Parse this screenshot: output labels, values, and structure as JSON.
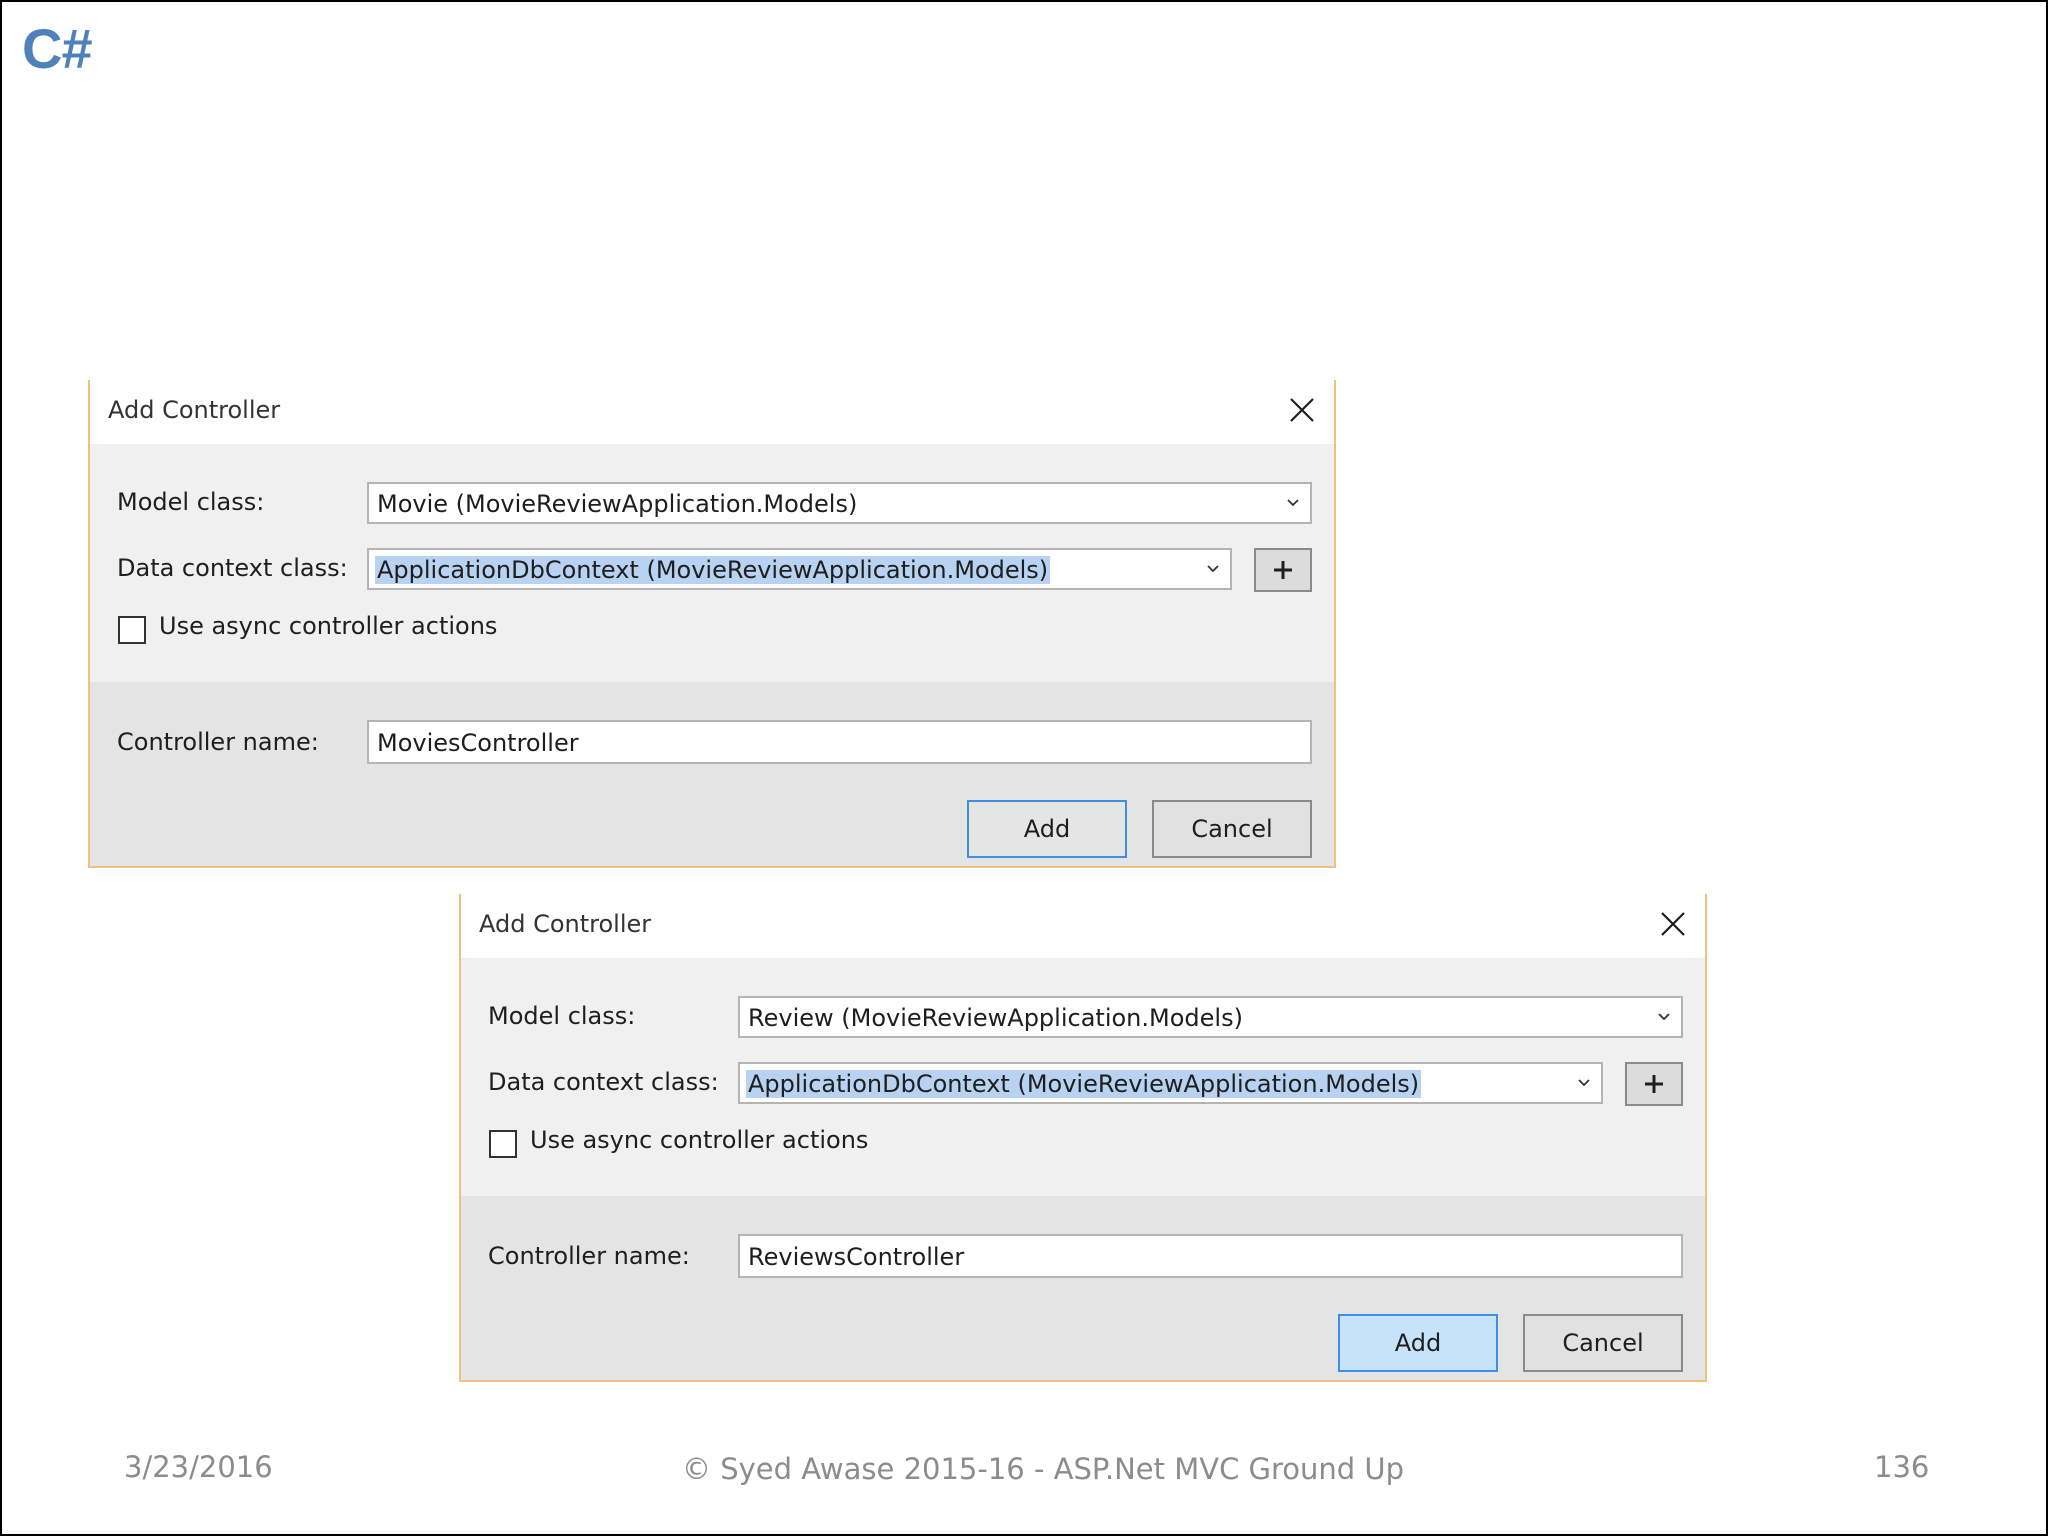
{
  "logo": "C#",
  "dialogs": [
    {
      "title": "Add Controller",
      "model_class_label": "Model class:",
      "model_class_value": "Movie (MovieReviewApplication.Models)",
      "data_context_label": "Data context class:",
      "data_context_value": "ApplicationDbContext (MovieReviewApplication.Models)",
      "async_label": "Use async controller actions",
      "async_checked": false,
      "controller_name_label": "Controller name:",
      "controller_name_value": "MoviesController",
      "add_label": "Add",
      "cancel_label": "Cancel"
    },
    {
      "title": "Add Controller",
      "model_class_label": "Model class:",
      "model_class_value": "Review (MovieReviewApplication.Models)",
      "data_context_label": "Data context class:",
      "data_context_value": "ApplicationDbContext (MovieReviewApplication.Models)",
      "async_label": "Use async controller actions",
      "async_checked": false,
      "controller_name_label": "Controller name:",
      "controller_name_value": "ReviewsController",
      "add_label": "Add",
      "cancel_label": "Cancel"
    }
  ],
  "footer": {
    "date": "3/23/2016",
    "copyright": "© Syed Awase 2015-16 - ASP.Net MVC Ground Up",
    "page_number": "136"
  },
  "colors": {
    "logo": "#4f81bd",
    "dialog_border": "#f1c27d",
    "selection": "#b7d3f1",
    "focus_border": "#3c8ee6"
  },
  "icons": {
    "close": "close-icon",
    "dropdown": "chevron-down-icon",
    "add_context": "plus-icon"
  }
}
